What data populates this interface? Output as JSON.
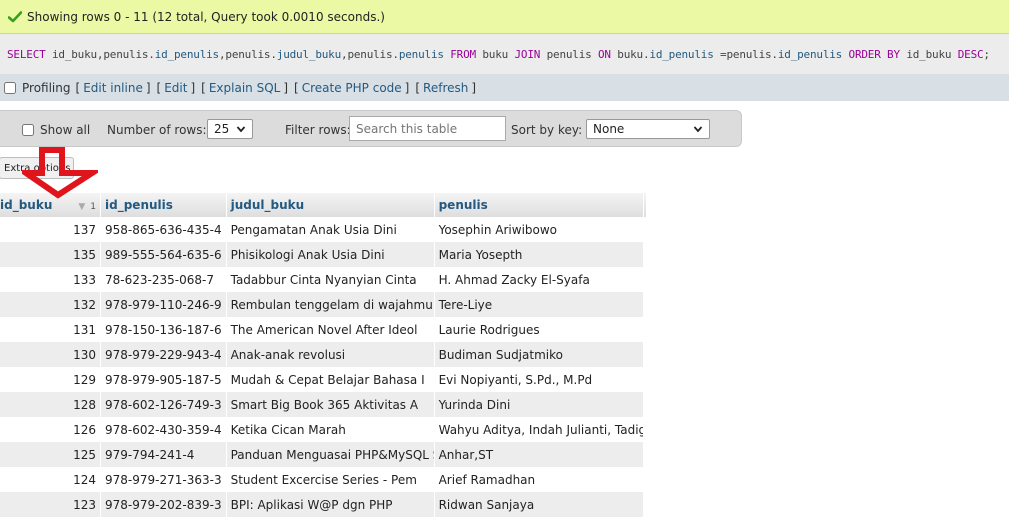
{
  "notice": {
    "message": "Showing rows 0 - 11 (12 total, Query took 0.0010 seconds.)",
    "icon": "check-icon"
  },
  "sql": {
    "parts": [
      {
        "t": "SELECT",
        "c": "kw"
      },
      {
        "t": " id_buku,penulis.",
        "c": "txt"
      },
      {
        "t": "id_penulis",
        "c": "fld"
      },
      {
        "t": ",penulis.",
        "c": "txt"
      },
      {
        "t": "judul_buku",
        "c": "fld"
      },
      {
        "t": ",penulis.",
        "c": "txt"
      },
      {
        "t": "penulis",
        "c": "fld"
      },
      {
        "t": " FROM ",
        "c": "kw"
      },
      {
        "t": "buku ",
        "c": "txt"
      },
      {
        "t": "JOIN",
        "c": "kw"
      },
      {
        "t": " penulis ",
        "c": "txt"
      },
      {
        "t": "ON",
        "c": "kw"
      },
      {
        "t": " buku.",
        "c": "txt"
      },
      {
        "t": "id_penulis",
        "c": "fld"
      },
      {
        "t": " =penulis.",
        "c": "txt"
      },
      {
        "t": "id_penulis",
        "c": "fld"
      },
      {
        "t": " ORDER BY",
        "c": "kw"
      },
      {
        "t": " id_buku ",
        "c": "txt"
      },
      {
        "t": "DESC",
        "c": "kw"
      },
      {
        "t": ";",
        "c": "txt"
      }
    ]
  },
  "links": {
    "profiling": "Profiling",
    "edit_inline": "Edit inline",
    "edit": "Edit",
    "explain_sql": "Explain SQL",
    "create_php": "Create PHP code",
    "refresh": "Refresh"
  },
  "nav": {
    "show_all": "Show all",
    "num_rows_label": "Number of rows:",
    "num_rows_value": "25",
    "filter_label": "Filter rows:",
    "filter_placeholder": "Search this table",
    "sort_label": "Sort by key:",
    "sort_value": "None"
  },
  "extra_options": "Extra options",
  "table": {
    "columns": [
      "id_buku",
      "id_penulis",
      "judul_buku",
      "penulis"
    ],
    "sort_order_number": "1",
    "rows": [
      [
        "137",
        "958-865-636-435-4",
        "Pengamatan Anak Usia Dini",
        "Yosephin Ariwibowo"
      ],
      [
        "135",
        "989-555-564-635-6",
        "Phisikologi Anak Usia Dini",
        "Maria Yosepth"
      ],
      [
        "133",
        "78-623-235-068-7",
        "Tadabbur Cinta Nyanyian Cinta",
        "H. Ahmad Zacky El-Syafa"
      ],
      [
        "132",
        "978-979-110-246-9",
        "Rembulan tenggelam di wajahmu",
        "Tere-Liye"
      ],
      [
        "131",
        "978-150-136-187-6",
        "The American Novel After Ideol",
        "Laurie Rodrigues"
      ],
      [
        "130",
        "978-979-229-943-4",
        "Anak-anak revolusi",
        "Budiman Sudjatmiko"
      ],
      [
        "129",
        "978-979-905-187-5",
        "Mudah & Cepat Belajar Bahasa I",
        "Evi Nopiyanti, S.Pd., M.Pd"
      ],
      [
        "128",
        "978-602-126-749-3",
        "Smart Big Book 365 Aktivitas A",
        "Yurinda Dini"
      ],
      [
        "126",
        "978-602-430-359-4",
        "Ketika Cican Marah",
        "Wahyu Aditya, Indah Julianti, Tadiga K."
      ],
      [
        "125",
        "979-794-241-4",
        "Panduan Menguasai PHP&MySQL Se",
        "Anhar,ST"
      ],
      [
        "124",
        "978-979-271-363-3",
        "Student Excercise Series - Pem",
        "Arief Ramadhan"
      ],
      [
        "123",
        "978-979-202-839-3",
        "BPI: Aplikasi W@P dgn PHP",
        "Ridwan Sanjaya"
      ]
    ]
  },
  "colors": {
    "success_bg": "#ebf8a4",
    "link": "#235a81",
    "annotation_arrow": "#e0141b"
  }
}
